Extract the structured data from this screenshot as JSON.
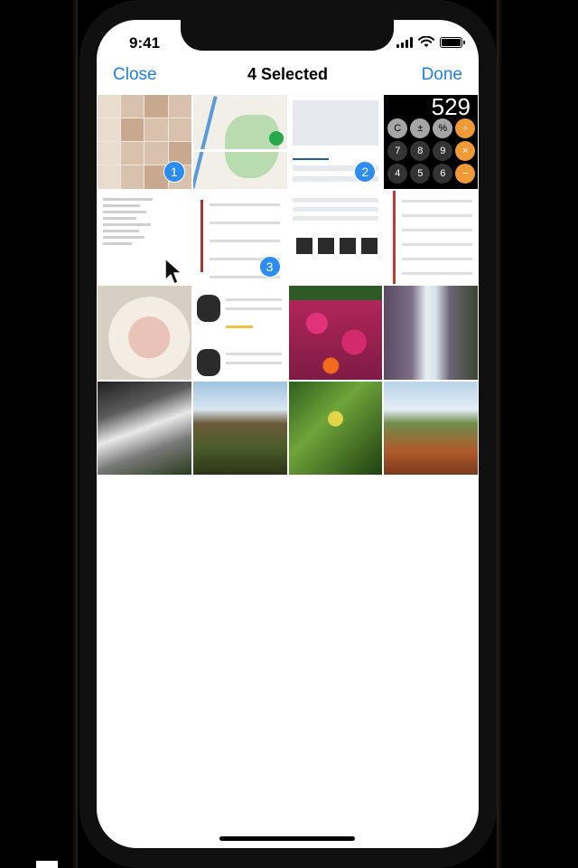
{
  "status_bar": {
    "time": "9:41"
  },
  "nav": {
    "close_label": "Close",
    "title": "4 Selected",
    "done_label": "Done"
  },
  "grid": {
    "selection_badges": {
      "cell_1": "1",
      "cell_3": "2",
      "cell_6": "3"
    },
    "calculator_display": "529",
    "calculator_keys": [
      "C",
      "±",
      "%",
      "÷",
      "7",
      "8",
      "9",
      "×",
      "4",
      "5",
      "6",
      "−"
    ]
  },
  "colors": {
    "accent": "#1f7fe0",
    "badge": "#2d8cf0"
  }
}
